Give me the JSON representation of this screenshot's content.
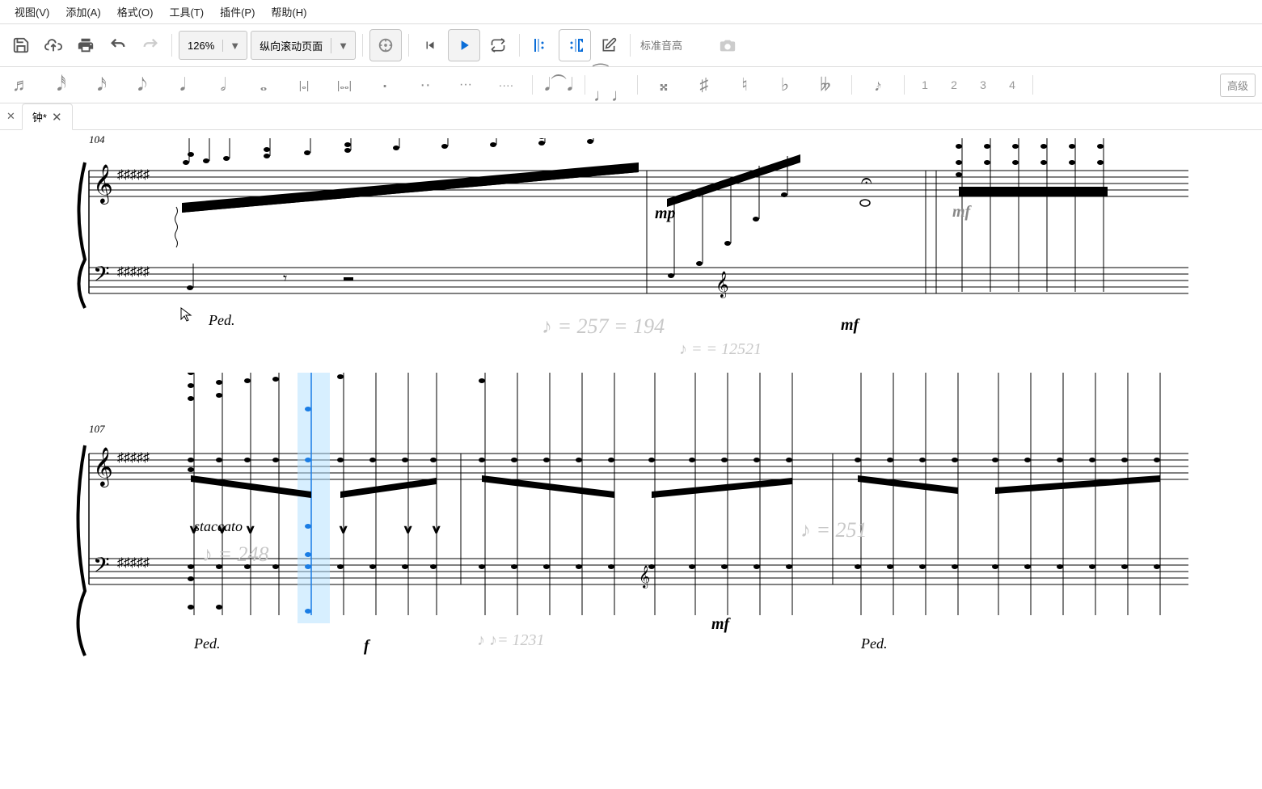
{
  "menu": {
    "view": "视图(V)",
    "add": "添加(A)",
    "format": "格式(O)",
    "tools": "工具(T)",
    "plugins": "插件(P)",
    "help": "帮助(H)"
  },
  "toolbar": {
    "zoom": "126%",
    "page_mode": "纵向滚动页面",
    "pitch_placeholder": "标准音高"
  },
  "notebar": {
    "nums": [
      "1",
      "2",
      "3",
      "4"
    ],
    "advanced": "高级"
  },
  "tab": {
    "name": "钟*"
  },
  "score": {
    "measure_104": "104",
    "measure_107": "107",
    "tempo1": "♪ = 257 = 194",
    "tempo2": "♪ = = 12521",
    "tempo3": "♪ = 248",
    "tempo4": "♪ = 251",
    "tempo5": "♪ ♪= 1231",
    "staccato": "staccato",
    "dyn_mp": "mp",
    "dyn_mf": "mf",
    "dyn_mf2": "mf",
    "dyn_f": "f",
    "ped": "Ped."
  }
}
